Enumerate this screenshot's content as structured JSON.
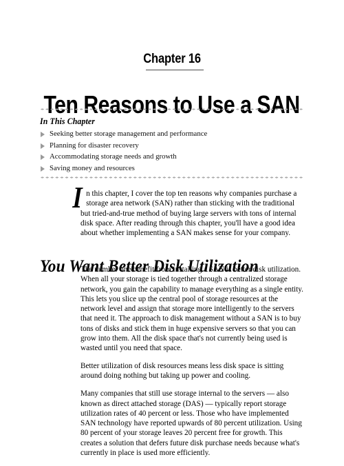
{
  "page": {
    "chapter_label": "Chapter 16",
    "title": "Ten Reasons to Use a SAN"
  },
  "in_this_chapter": {
    "heading": "In This Chapter",
    "bullet_icon": "triangle-right-icon",
    "items": [
      "Seeking better storage management and performance",
      "Planning for disaster recovery",
      "Accommodating storage needs and growth",
      "Saving money and resources"
    ]
  },
  "intro": {
    "dropcap": "I",
    "text": "n this chapter, I cover the top ten reasons why companies purchase a storage area network (SAN) rather than sticking with the traditional but tried-and-true method of buying large servers with tons of internal disk space. After reading through this chapter, you'll have a good idea about whether implementing a SAN makes sense for your company."
  },
  "section": {
    "heading": "You Want Better Disk Utilization",
    "paragraphs": [
      "The number one benefit from installing a SAN is better disk utilization. When all your storage is tied together through a centralized storage network, you gain the capability to manage everything as a single entity. This lets you slice up the central pool of storage resources at the network level and assign that storage more intelligently to the servers that need it. The approach to disk management without a SAN is to buy tons of disks and stick them in huge expensive servers so that you can grow into them. All the disk space that's not currently being used is wasted until you need that space.",
      "Better utilization of disk resources means less disk space is sitting around doing nothing but taking up power and cooling.",
      "Many companies that still use storage internal to the servers — also known as direct attached storage (DAS) — typically report storage utilization rates of 40 percent or less. Those who have implemented SAN technology have reported upwards of 80 percent utilization. Using 80 percent of your storage leaves 20 percent free for growth. This creates a solution that defers future disk purchase needs because what's currently in place is used more efficiently."
    ]
  },
  "colors": {
    "text": "#000000",
    "rule": "#4a4a4a",
    "dot_rule": "#a8a8a8",
    "bullet": "#9a9a9a",
    "background": "#ffffff"
  }
}
